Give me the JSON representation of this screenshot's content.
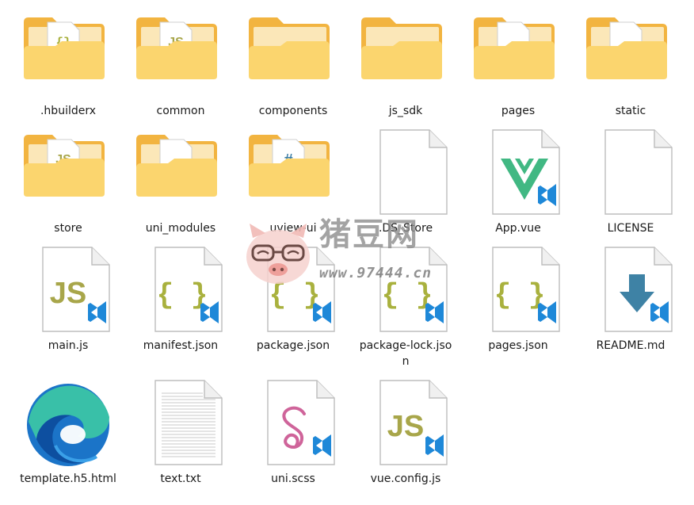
{
  "items": [
    {
      "name": "folder-hbuilderx",
      "label": ".hbuilderx",
      "type": "folder",
      "peek": "json"
    },
    {
      "name": "folder-common",
      "label": "common",
      "type": "folder",
      "peek": "js"
    },
    {
      "name": "folder-components",
      "label": "components",
      "type": "folder",
      "peek": "none"
    },
    {
      "name": "folder-js-sdk",
      "label": "js_sdk",
      "type": "folder",
      "peek": "none"
    },
    {
      "name": "folder-pages",
      "label": "pages",
      "type": "folder",
      "peek": "blank"
    },
    {
      "name": "folder-static",
      "label": "static",
      "type": "folder",
      "peek": "blank"
    },
    {
      "name": "folder-store",
      "label": "store",
      "type": "folder",
      "peek": "js"
    },
    {
      "name": "folder-uni-modules",
      "label": "uni_modules",
      "type": "folder",
      "peek": "blank"
    },
    {
      "name": "folder-uview-ui",
      "label": "uview-ui",
      "type": "folder",
      "peek": "hash"
    },
    {
      "name": "file-ds-store",
      "label": ".DS_Store",
      "type": "blank"
    },
    {
      "name": "file-app-vue",
      "label": "App.vue",
      "type": "vue"
    },
    {
      "name": "file-license",
      "label": "LICENSE",
      "type": "blank"
    },
    {
      "name": "file-main-js",
      "label": "main.js",
      "type": "js"
    },
    {
      "name": "file-manifest-json",
      "label": "manifest.json",
      "type": "json"
    },
    {
      "name": "file-package-json",
      "label": "package.json",
      "type": "json"
    },
    {
      "name": "file-package-lock-json",
      "label": "package-lock.json",
      "type": "json"
    },
    {
      "name": "file-pages-json",
      "label": "pages.json",
      "type": "json"
    },
    {
      "name": "file-readme-md",
      "label": "README.md",
      "type": "md"
    },
    {
      "name": "file-template-h5-html",
      "label": "template.h5.html",
      "type": "edge"
    },
    {
      "name": "file-text-txt",
      "label": "text.txt",
      "type": "txt"
    },
    {
      "name": "file-uni-scss",
      "label": "uni.scss",
      "type": "scss"
    },
    {
      "name": "file-vue-config-js",
      "label": "vue.config.js",
      "type": "js"
    }
  ],
  "watermark": {
    "brand": "猪豆网",
    "site": "www.97444.cn"
  },
  "colors": {
    "folder_back": "#f2b440",
    "folder_front": "#fbd56e",
    "js_text": "#a8a64a",
    "json_text": "#a9b13e",
    "vscode_blue": "#1e88d8",
    "vue_green": "#41b883",
    "md_blue": "#3e82a5",
    "scss_pink": "#cf649a"
  }
}
